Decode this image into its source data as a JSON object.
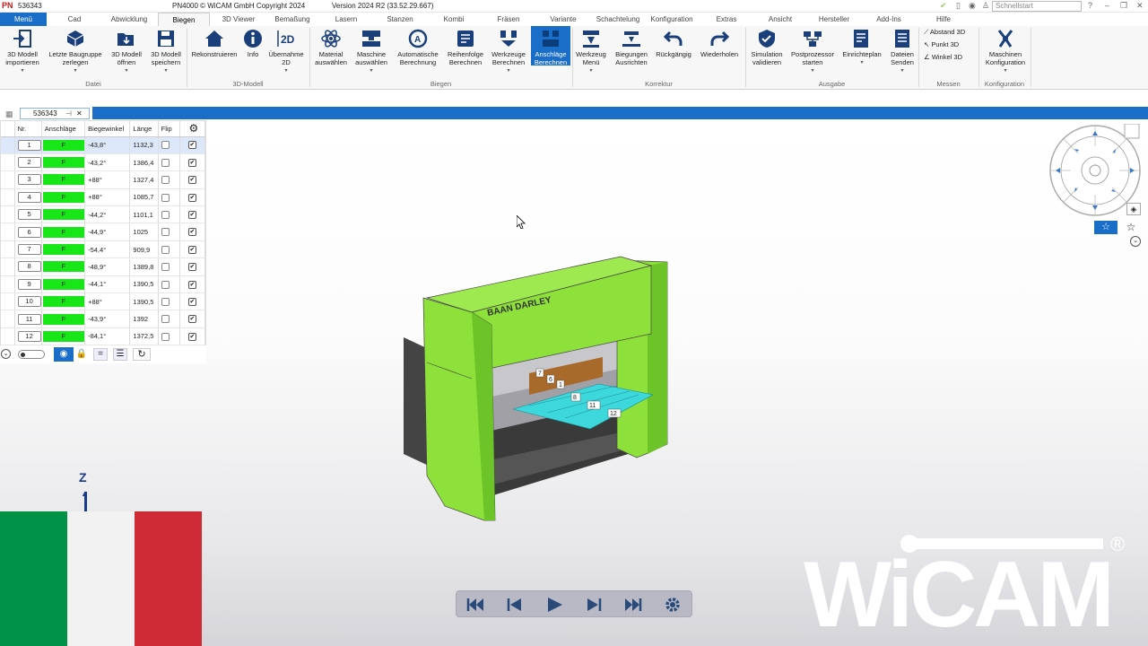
{
  "titlebar": {
    "logo": "PN",
    "doc": "536343",
    "app": "PN4000 © WiCAM GmbH Copyright 2024",
    "version": "Version 2024 R2 (33.52.29.667)",
    "search_placeholder": "Schnellstart"
  },
  "tabs": [
    "Menü",
    "Cad",
    "Abwicklung",
    "Biegen",
    "3D Viewer",
    "Bemaßung",
    "Lasern",
    "Stanzen",
    "Kombi",
    "Fräsen",
    "Variante",
    "Schachtelung",
    "Konfiguration",
    "Extras",
    "Ansicht",
    "Hersteller",
    "Add-Ins",
    "Hilfe"
  ],
  "ribbon": {
    "buttons": [
      "3D Modell importieren",
      "Letzte Baugruppe zerlegen",
      "3D Modell öffnen",
      "3D Modell speichern",
      "Rekonstruieren",
      "Info",
      "Übernahme 2D",
      "Material auswählen",
      "Maschine auswählen",
      "Automatische Berechnung",
      "Reihenfolge Berechnen",
      "Werkzeuge Berechnen",
      "Anschläge Berechnen",
      "Werkzeug Menü",
      "Biegungen Ausrichten",
      "Rückgängig",
      "Wiederholen",
      "Simulation validieren",
      "Postprozessor starten",
      "Einrichteplan",
      "Dateien Senden",
      "Maschinen Konfiguration"
    ],
    "measure": [
      "Abstand 3D",
      "Punkt 3D",
      "Winkel 3D"
    ],
    "groups": [
      "Datei",
      "3D-Modell",
      "Biegen",
      "Korrektur",
      "Ausgabe",
      "Messen",
      "Konfiguration"
    ],
    "icon_2d": "2D"
  },
  "doc_tab": "536343",
  "table": {
    "headers": [
      "Nr.",
      "Anschläge",
      "Biegewinkel",
      "Länge",
      "Flip"
    ],
    "rows": [
      {
        "nr": "1",
        "ans": "F",
        "winkel": "-43,8°",
        "laenge": "1132,3"
      },
      {
        "nr": "2",
        "ans": "F",
        "winkel": "-43,2°",
        "laenge": "1386,4"
      },
      {
        "nr": "3",
        "ans": "F",
        "winkel": "+88°",
        "laenge": "1327,4"
      },
      {
        "nr": "4",
        "ans": "F",
        "winkel": "+88°",
        "laenge": "1085,7"
      },
      {
        "nr": "5",
        "ans": "F",
        "winkel": "-44,2°",
        "laenge": "1101,1"
      },
      {
        "nr": "6",
        "ans": "F",
        "winkel": "-44,9°",
        "laenge": "1025"
      },
      {
        "nr": "7",
        "ans": "F",
        "winkel": "-54,4°",
        "laenge": "909,9"
      },
      {
        "nr": "8",
        "ans": "F",
        "winkel": "-48,9°",
        "laenge": "1389,8"
      },
      {
        "nr": "9",
        "ans": "F",
        "winkel": "-44,1°",
        "laenge": "1390,5"
      },
      {
        "nr": "10",
        "ans": "F",
        "winkel": "+88°",
        "laenge": "1390,5"
      },
      {
        "nr": "11",
        "ans": "F",
        "winkel": "-43,9°",
        "laenge": "1392"
      },
      {
        "nr": "12",
        "ans": "F",
        "winkel": "-84,1°",
        "laenge": "1372,5"
      }
    ]
  },
  "machine_logo": "BAAN DARLEY",
  "bend_labels": [
    "7",
    "6",
    "1",
    "8",
    "11",
    "12"
  ],
  "axis_label": "Z",
  "brand": {
    "name": "WiCAM",
    "registered": "®"
  },
  "colors": {
    "accent": "#1a6ec7",
    "stop_green": "#19e619",
    "machine_green": "#8ee03a",
    "sheet": "#3cd8dc"
  }
}
